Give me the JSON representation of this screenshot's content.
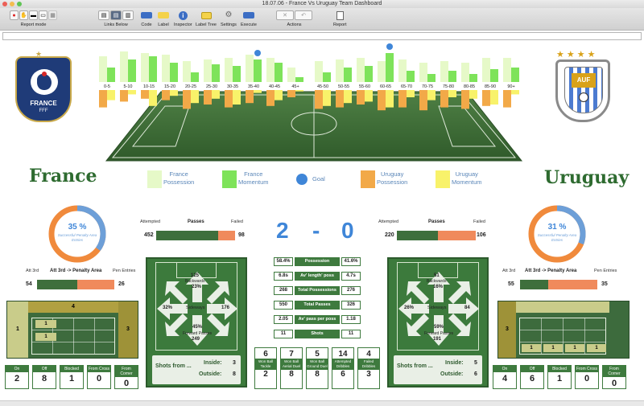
{
  "window": {
    "title": "18.07.06 - France Vs Uruguay Team Dashboard"
  },
  "toolbar": {
    "groups": [
      {
        "label": "Report mode"
      },
      {
        "label": "Links Below"
      },
      {
        "label": "Code"
      },
      {
        "label": "Label"
      },
      {
        "label": "Inspector"
      },
      {
        "label": "Label Tree"
      },
      {
        "label": "Settings"
      },
      {
        "label": "Execute"
      },
      {
        "label": "Actions"
      },
      {
        "label": "Report"
      }
    ]
  },
  "teams": {
    "home": {
      "name": "France",
      "crest_text": "FRANCE",
      "crest_sub": "FFF"
    },
    "away": {
      "name": "Uruguay",
      "crest_text": "AUF"
    }
  },
  "timeline": {
    "bins": [
      "0-5",
      "5-10",
      "10-15",
      "15-20",
      "20-25",
      "25-30",
      "30-35",
      "35-40",
      "40-45",
      "45+",
      "45-50",
      "50-55",
      "55-60",
      "60-65",
      "65-70",
      "70-75",
      "75-80",
      "80-85",
      "85-90",
      "90+"
    ],
    "france_possession": [
      32,
      38,
      36,
      34,
      26,
      28,
      30,
      34,
      30,
      18,
      26,
      28,
      30,
      26,
      28,
      24,
      26,
      24,
      30,
      30
    ],
    "france_momentum": [
      18,
      28,
      32,
      24,
      12,
      22,
      20,
      28,
      24,
      6,
      12,
      18,
      20,
      36,
      14,
      10,
      14,
      10,
      16,
      18
    ],
    "uruguay_possession": [
      24,
      16,
      12,
      14,
      26,
      20,
      24,
      18,
      22,
      10,
      26,
      24,
      20,
      28,
      24,
      28,
      24,
      26,
      22,
      24
    ],
    "uruguay_momentum": [
      14,
      6,
      22,
      8,
      18,
      12,
      20,
      4,
      14,
      2,
      22,
      18,
      16,
      24,
      10,
      14,
      10,
      12,
      20,
      6
    ],
    "goal_bins": [
      "35-40",
      "60-65"
    ]
  },
  "legend": [
    {
      "line1": "France",
      "line2": "Possession",
      "color": "#e6f9c8"
    },
    {
      "line1": "France",
      "line2": "Momentum",
      "color": "#7ee35a"
    },
    {
      "line1": "Goal",
      "line2": "",
      "color": "#3f86d8"
    },
    {
      "line1": "Uruguay",
      "line2": "Possession",
      "color": "#f2a948"
    },
    {
      "line1": "Uruguay",
      "line2": "Momentum",
      "color": "#f8f26a"
    }
  ],
  "score": {
    "home": "2",
    "sep": "-",
    "away": "0"
  },
  "penalty_entries": {
    "home": {
      "pct": "35 %",
      "caption": "Successful Penalty Area Entries",
      "value": 35
    },
    "away": {
      "pct": "31 %",
      "caption": "Successful Penalty Area Entries",
      "value": 31
    }
  },
  "passes": {
    "header_attempted": "Attempted",
    "header_title": "Passes",
    "header_failed": "Failed",
    "home": {
      "attempted": "452",
      "failed": "98",
      "a": 452,
      "f": 98
    },
    "away": {
      "attempted": "220",
      "failed": "106",
      "a": 220,
      "f": 106
    }
  },
  "att3rd": {
    "header_left": "Att 3rd",
    "header_title": "Att 3rd -> Penalty Area",
    "header_right": "Pen Entries",
    "home": {
      "att": "54",
      "pen": "26",
      "a": 54,
      "p": 26
    },
    "away": {
      "att": "55",
      "pen": "35",
      "a": 55,
      "p": 35
    }
  },
  "zones": {
    "home": {
      "top": "4",
      "left": "1",
      "right": "3",
      "cells": [
        "1",
        "1"
      ]
    },
    "away": {
      "left": "3",
      "cells": [
        "1",
        "1",
        "1",
        "1"
      ]
    }
  },
  "directions": {
    "home": {
      "backwards": "125",
      "backwards_pct": "23%",
      "sideways_label": "Sideways",
      "left_pct": "32%",
      "right": "176",
      "forward_pct": "45%",
      "forward_label": "Forward Passes",
      "forward": "249",
      "backwards_label": "Backwards"
    },
    "away": {
      "backwards": "51",
      "backwards_pct": "16%",
      "sideways_label": "Sideways",
      "left_pct": "26%",
      "right": "84",
      "forward_pct": "59%",
      "forward_label": "Forward Passes",
      "forward": "191",
      "backwards_label": "Backwards"
    }
  },
  "shots_from": {
    "home": {
      "title": "Shots from ...",
      "inside_label": "Inside:",
      "inside": "3",
      "outside_label": "Outside:",
      "outside": "8"
    },
    "away": {
      "title": "Shots from ...",
      "inside_label": "Inside:",
      "inside": "5",
      "outside_label": "Outside:",
      "outside": "6"
    }
  },
  "stats": [
    {
      "home": "58.4%",
      "label": "Possession",
      "away": "41.6%"
    },
    {
      "home": "6.8s",
      "label": "Av' length' poss",
      "away": "4.7s"
    },
    {
      "home": "268",
      "label": "Total Possessions",
      "away": "276"
    },
    {
      "home": "550",
      "label": "Total Passes",
      "away": "326"
    },
    {
      "home": "2.05",
      "label": "Av' pass per poss",
      "away": "1.18"
    },
    {
      "home": "11",
      "label": "Shots",
      "away": "11"
    }
  ],
  "center_kpis": [
    {
      "value": "6",
      "label": "Won Ball Tackle",
      "value2": "2"
    },
    {
      "value": "7",
      "label": "Won Ball Aerial Duel",
      "value2": "8"
    },
    {
      "value": "5",
      "label": "Won Ball Ground Duel",
      "value2": "8"
    },
    {
      "value": "14",
      "label": "Attempted Dribbles",
      "value2": "6"
    },
    {
      "value": "4",
      "label": "Failed Dribbles",
      "value2": "3"
    }
  ],
  "setpieces": {
    "labels": [
      "On",
      "Off",
      "Blocked",
      "From Cross",
      "From Corner"
    ],
    "home": [
      "2",
      "8",
      "1",
      "0",
      "0"
    ],
    "away": [
      "4",
      "6",
      "1",
      "0",
      "0"
    ]
  }
}
